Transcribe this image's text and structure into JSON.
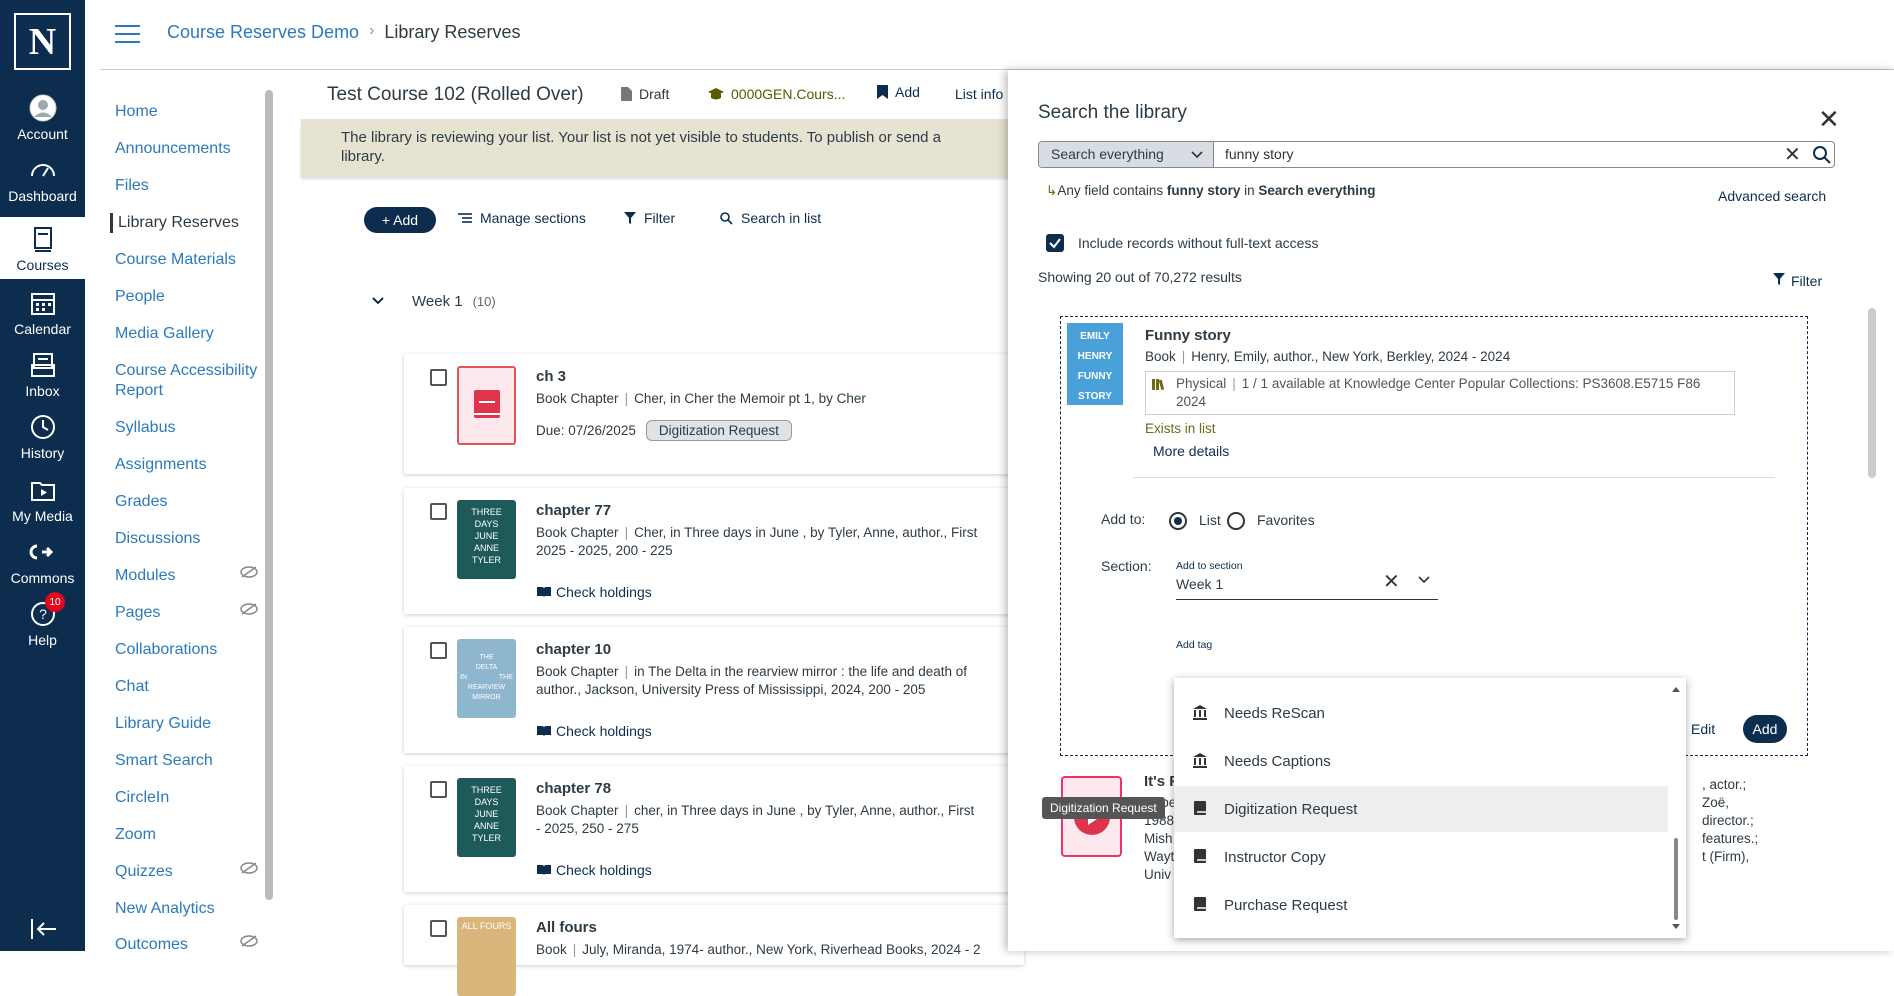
{
  "global_nav": {
    "logo": "N",
    "items": [
      {
        "label": "Account"
      },
      {
        "label": "Dashboard"
      },
      {
        "label": "Courses"
      },
      {
        "label": "Calendar"
      },
      {
        "label": "Inbox"
      },
      {
        "label": "History"
      },
      {
        "label": "My Media"
      },
      {
        "label": "Commons"
      },
      {
        "label": "Help",
        "badge": "10"
      }
    ]
  },
  "breadcrumb": {
    "course": "Course Reserves Demo",
    "separator": "›",
    "current": "Library Reserves"
  },
  "course_nav": [
    {
      "label": "Home"
    },
    {
      "label": "Announcements"
    },
    {
      "label": "Files"
    },
    {
      "label": "Library Reserves"
    },
    {
      "label": "Course Materials"
    },
    {
      "label": "People"
    },
    {
      "label": "Media Gallery"
    },
    {
      "label": "Course Accessibility Report"
    },
    {
      "label": "Syllabus"
    },
    {
      "label": "Assignments"
    },
    {
      "label": "Grades"
    },
    {
      "label": "Discussions"
    },
    {
      "label": "Modules"
    },
    {
      "label": "Pages"
    },
    {
      "label": "Collaborations"
    },
    {
      "label": "Chat"
    },
    {
      "label": "Library Guide"
    },
    {
      "label": "Smart Search"
    },
    {
      "label": "CircleIn"
    },
    {
      "label": "Zoom"
    },
    {
      "label": "Quizzes"
    },
    {
      "label": "New Analytics"
    },
    {
      "label": "Outcomes"
    }
  ],
  "list_header": {
    "title": "Test Course 102 (Rolled Over)",
    "status": "Draft",
    "course_code": "0000GEN.Cours...",
    "add": "Add",
    "list_info": "List info"
  },
  "banner": {
    "text": "The library is reviewing your list. Your list is not yet visible to students. To publish or send a library."
  },
  "toolbar": {
    "add": "+ Add",
    "manage": "Manage sections",
    "filter": "Filter",
    "search": "Search in list"
  },
  "section": {
    "name": "Week 1",
    "count": "(10)"
  },
  "items": [
    {
      "title": "ch 3",
      "type": "Book Chapter",
      "desc": "Cher, in Cher the Memoir pt 1, by Cher",
      "due": "Due: 07/26/2025",
      "tag": "Digitization Request"
    },
    {
      "title": "chapter 77",
      "type": "Book Chapter",
      "desc": "Cher, in Three days in June , by Tyler, Anne, author., First",
      "desc2": "2025 - 2025, 200 - 225",
      "holdings": "Check holdings",
      "cover_text": "THREE DAYS JUNE ANNE TYLER"
    },
    {
      "title": "chapter 10",
      "type": "Book Chapter",
      "desc": "in The Delta in the rearview mirror : the life and death of",
      "desc2": "author., Jackson, University Press of Mississippi, 2024, 200 - 205",
      "holdings": "Check holdings",
      "cover_text": "THE DELTA IN THE REARVIEW MIRROR"
    },
    {
      "title": "chapter 78",
      "type": "Book Chapter",
      "desc": "cher, in Three days in June , by Tyler, Anne, author., First",
      "desc2": "- 2025, 250 - 275",
      "holdings": "Check holdings",
      "cover_text": "THREE DAYS JUNE ANNE TYLER"
    },
    {
      "title": "All fours",
      "type": "Book",
      "desc": "July, Miranda, 1974- author., New York, Riverhead Books, 2024 - 2",
      "cover_text": "ALL FOURS"
    }
  ],
  "search_panel": {
    "title": "Search the library",
    "scope": "Search everything",
    "query": "funny story",
    "query_desc_prefix": "Any field contains ",
    "query_desc_term": "funny story",
    "query_desc_mid": " in ",
    "query_desc_scope": "Search everything",
    "advanced": "Advanced search",
    "include_label": "Include records without full-text access",
    "showing": "Showing 20 out of 70,272 results",
    "filter": "Filter",
    "result": {
      "title": "Funny story",
      "type": "Book",
      "meta": "Henry, Emily, author., New York, Berkley, 2024 - 2024",
      "holding_type": "Physical",
      "holding_detail": "1 / 1 available at Knowledge Center Popular Collections: PS3608.E5715 F86",
      "holding_year": "2024",
      "exists": "Exists in list",
      "more": "More details",
      "cover_text": "EMILY HENRY FUNNY STORY",
      "add_to_label": "Add to:",
      "opt_list": "List",
      "opt_fav": "Favorites",
      "section_label": "Section:",
      "add_to_section": "Add to section",
      "section_value": "Week 1",
      "add_tag": "Add tag",
      "edit": "Edit",
      "add": "Add"
    },
    "result2": {
      "title": "It's R",
      "lines": [
        "Robe",
        "1988",
        "Mish",
        "Wayt",
        "Univ"
      ],
      "right": [
        ", actor.;",
        "Zoë,",
        "director.;",
        "features.;",
        "t (Firm),"
      ]
    },
    "tooltip": "Digitization Request",
    "dropdown": [
      "Needs ReScan",
      "Needs Captions",
      "Digitization Request",
      "Instructor Copy",
      "Purchase Request"
    ]
  }
}
